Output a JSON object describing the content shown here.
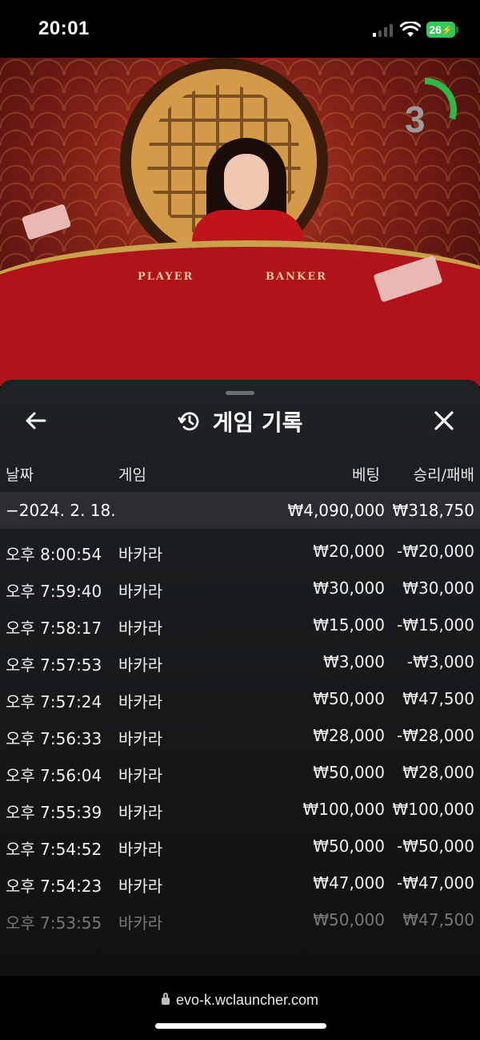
{
  "status_bar": {
    "time": "20:01",
    "battery": "26"
  },
  "live_video": {
    "player_label": "PLAYER",
    "banker_label": "BANKER",
    "countdown": "3",
    "countdown_progress": 0.3,
    "countdown_color": "#2fb84a"
  },
  "sheet": {
    "title": "게임 기록",
    "columns": {
      "date": "날짜",
      "game": "게임",
      "bet": "베팅",
      "result": "승리/패배"
    },
    "group": {
      "date": "−2024. 2. 18.",
      "bet_total": "₩4,090,000",
      "result_total": "₩318,750"
    },
    "rows": [
      {
        "time": "오후 8:00:54",
        "game": "바카라",
        "bet": "₩20,000",
        "result": "-₩20,000"
      },
      {
        "time": "오후 7:59:40",
        "game": "바카라",
        "bet": "₩30,000",
        "result": "₩30,000"
      },
      {
        "time": "오후 7:58:17",
        "game": "바카라",
        "bet": "₩15,000",
        "result": "-₩15,000"
      },
      {
        "time": "오후 7:57:53",
        "game": "바카라",
        "bet": "₩3,000",
        "result": "-₩3,000"
      },
      {
        "time": "오후 7:57:24",
        "game": "바카라",
        "bet": "₩50,000",
        "result": "₩47,500"
      },
      {
        "time": "오후 7:56:33",
        "game": "바카라",
        "bet": "₩28,000",
        "result": "-₩28,000"
      },
      {
        "time": "오후 7:56:04",
        "game": "바카라",
        "bet": "₩50,000",
        "result": "₩28,000"
      },
      {
        "time": "오후 7:55:39",
        "game": "바카라",
        "bet": "₩100,000",
        "result": "₩100,000"
      },
      {
        "time": "오후 7:54:52",
        "game": "바카라",
        "bet": "₩50,000",
        "result": "-₩50,000"
      },
      {
        "time": "오후 7:54:23",
        "game": "바카라",
        "bet": "₩47,000",
        "result": "-₩47,000"
      },
      {
        "time": "오후 7:53:55",
        "game": "바카라",
        "bet": "₩50,000",
        "result": "₩47,500"
      }
    ]
  },
  "browser": {
    "url": "evo-k.wclauncher.com"
  }
}
